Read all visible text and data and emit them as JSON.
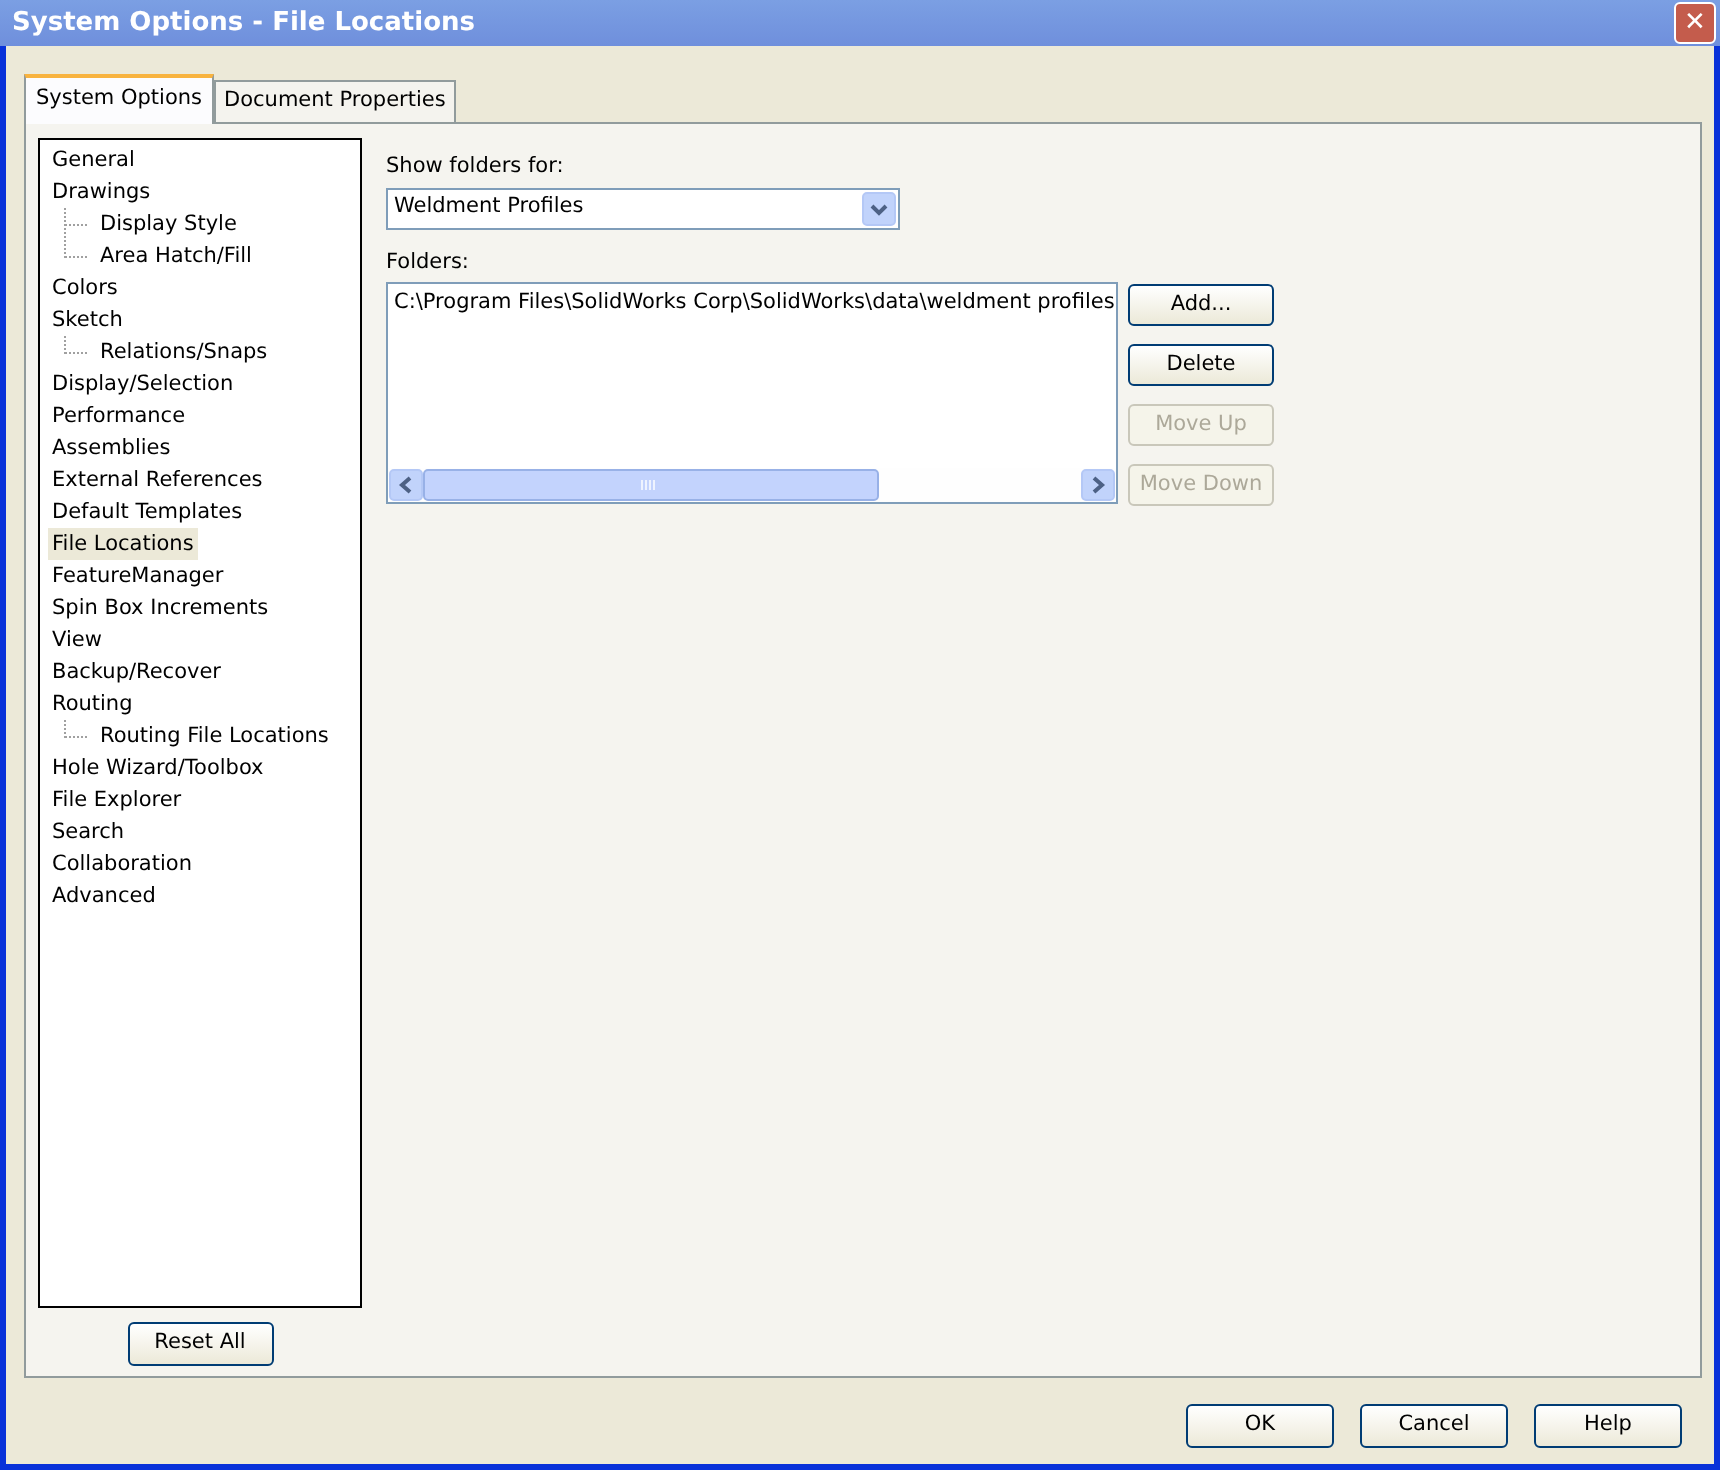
{
  "window": {
    "title": "System Options - File Locations",
    "close": "✕"
  },
  "tabs": [
    {
      "label": "System Options",
      "selected": true
    },
    {
      "label": "Document Properties",
      "selected": false
    }
  ],
  "tree": [
    {
      "label": "General",
      "selected": false
    },
    {
      "label": "Drawings",
      "selected": false,
      "children": [
        {
          "label": "Display Style",
          "selected": false
        },
        {
          "label": "Area Hatch/Fill",
          "selected": false
        }
      ]
    },
    {
      "label": "Colors",
      "selected": false
    },
    {
      "label": "Sketch",
      "selected": false,
      "children": [
        {
          "label": "Relations/Snaps",
          "selected": false
        }
      ]
    },
    {
      "label": "Display/Selection",
      "selected": false
    },
    {
      "label": "Performance",
      "selected": false
    },
    {
      "label": "Assemblies",
      "selected": false
    },
    {
      "label": "External References",
      "selected": false
    },
    {
      "label": "Default Templates",
      "selected": false
    },
    {
      "label": "File Locations",
      "selected": true
    },
    {
      "label": "FeatureManager",
      "selected": false
    },
    {
      "label": "Spin Box Increments",
      "selected": false
    },
    {
      "label": "View",
      "selected": false
    },
    {
      "label": "Backup/Recover",
      "selected": false
    },
    {
      "label": "Routing",
      "selected": false,
      "children": [
        {
          "label": "Routing File Locations",
          "selected": false
        }
      ]
    },
    {
      "label": "Hole Wizard/Toolbox",
      "selected": false
    },
    {
      "label": "File Explorer",
      "selected": false
    },
    {
      "label": "Search",
      "selected": false
    },
    {
      "label": "Collaboration",
      "selected": false
    },
    {
      "label": "Advanced",
      "selected": false
    }
  ],
  "reset_button": "Reset All",
  "show_folders_label": "Show folders for:",
  "show_folders_value": "Weldment Profiles",
  "folders_label": "Folders:",
  "folders": [
    "C:\\Program Files\\SolidWorks Corp\\SolidWorks\\data\\weldment profiles"
  ],
  "folder_buttons": [
    {
      "label": "Add...",
      "disabled": false
    },
    {
      "label": "Delete",
      "disabled": false
    },
    {
      "label": "Move Up",
      "disabled": true
    },
    {
      "label": "Move Down",
      "disabled": true
    }
  ],
  "dialog_buttons": [
    "OK",
    "Cancel",
    "Help"
  ]
}
